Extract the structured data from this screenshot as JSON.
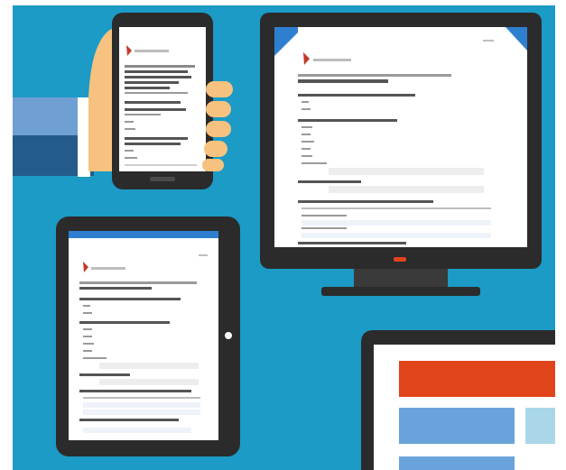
{
  "colors": {
    "background": "#1b9bc6",
    "device_body": "#2b2b2b",
    "screen": "#ffffff",
    "header_blue": "#2f7fd0",
    "brand_red": "#c0392b",
    "accent_orange": "#e0441b",
    "light_blue": "#6aa3dc",
    "pale_blue": "#a9d7e8",
    "sleeve_light": "#6f9fd3",
    "sleeve_dark": "#245b8c",
    "skin": "#f7c27f",
    "text_gray": "#8a8a8a",
    "text_dark": "#555555"
  },
  "icons": {
    "brand_logo": "red-bird-logo",
    "home_button": "home-button-icon",
    "power_led": "power-indicator-icon"
  }
}
